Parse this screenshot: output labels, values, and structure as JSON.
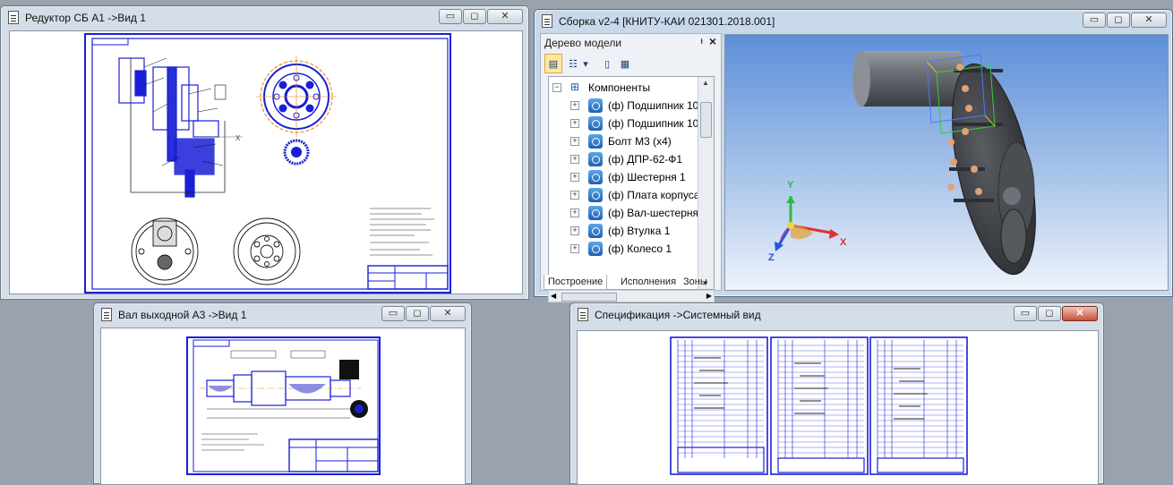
{
  "windows": {
    "reducer": {
      "title": "Редуктор СБ А1 ->Вид 1"
    },
    "assembly": {
      "title": "Сборка v2-4 [КНИТУ-КАИ 021301.2018.001]"
    },
    "shaft": {
      "title": "Вал выходной А3 ->Вид 1"
    },
    "spec": {
      "title": "Спецификация ->Системный вид"
    }
  },
  "window_buttons": {
    "minimize": "▭",
    "maximize": "◻",
    "close": "✕"
  },
  "model_tree": {
    "title": "Дерево модели",
    "pin": "ᵼ",
    "close": "×",
    "root": "Компоненты",
    "items": [
      {
        "label": "(ф) Подшипник 10"
      },
      {
        "label": "(ф) Подшипник 10"
      },
      {
        "label": "Болт М3 (х4)"
      },
      {
        "label": "(ф) ДПР-62-Ф1"
      },
      {
        "label": "(ф) Шестерня 1"
      },
      {
        "label": "(ф) Плата корпуса"
      },
      {
        "label": "(ф) Вал-шестерня"
      },
      {
        "label": "(ф) Втулка 1"
      },
      {
        "label": "(ф) Колесо 1"
      }
    ],
    "tabs": [
      "Построение",
      "Исполнения",
      "Зоны"
    ],
    "active_tab": "Построение"
  },
  "axes": {
    "x": "X",
    "y": "Y",
    "z": "Z"
  },
  "colors": {
    "drawing_blue": "#1a1fd6",
    "axis_x": "#e03030",
    "axis_y": "#2db84a",
    "axis_z": "#2555e0",
    "bg": "#9aa3ad"
  }
}
